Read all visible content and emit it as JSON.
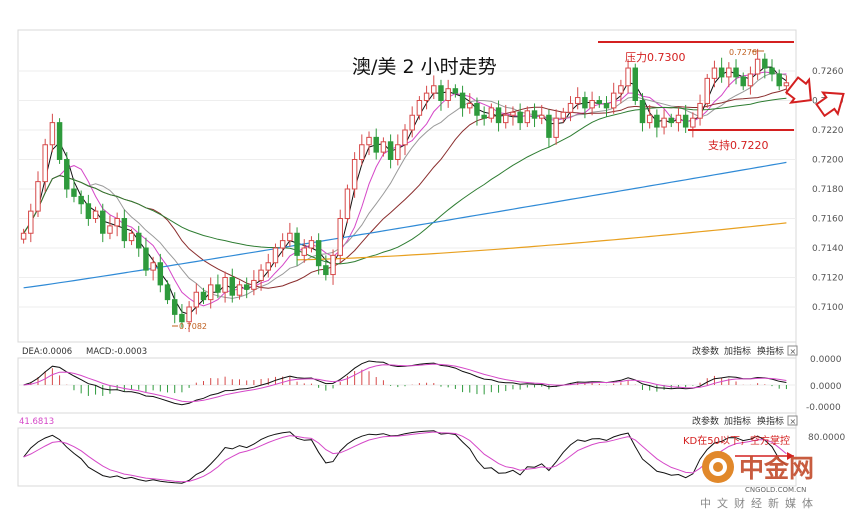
{
  "chart_data": [
    {
      "type": "candlestick",
      "title": "澳/美 2 小时走势",
      "ylim": [
        0.708,
        0.729
      ],
      "yticks": [
        "0.7260",
        "0.7240",
        "0.7220",
        "0.7200",
        "0.7180",
        "0.7160",
        "0.7140",
        "0.7120",
        "0.7100"
      ],
      "annotations": {
        "resistance": {
          "label": "压力0.7300",
          "value": 0.73
        },
        "support": {
          "label": "支持0.7220",
          "value": 0.722
        },
        "high": {
          "label": "0.7276",
          "value": 0.7276
        },
        "low": {
          "label": "0.7082",
          "value": 0.7082
        }
      },
      "colors": {
        "up": "#d64a4a",
        "down": "#2e9a3c",
        "ma_black": "#111111",
        "ma_magenta": "#d548c8",
        "ma_gray": "#9a9a9a",
        "ma_brown": "#8a2d2d",
        "ma_green": "#2e7d32",
        "ma_blue": "#2f8ad6",
        "ma_orange": "#e8a020"
      },
      "closes": [
        0.715,
        0.7165,
        0.7185,
        0.721,
        0.7225,
        0.72,
        0.718,
        0.7175,
        0.717,
        0.716,
        0.7165,
        0.715,
        0.7155,
        0.716,
        0.7145,
        0.715,
        0.714,
        0.7125,
        0.713,
        0.7115,
        0.7105,
        0.7095,
        0.709,
        0.71,
        0.711,
        0.7105,
        0.7115,
        0.711,
        0.712,
        0.7108,
        0.7115,
        0.7112,
        0.7118,
        0.7125,
        0.713,
        0.714,
        0.7145,
        0.715,
        0.7135,
        0.714,
        0.7145,
        0.7128,
        0.7122,
        0.7135,
        0.716,
        0.718,
        0.72,
        0.721,
        0.7215,
        0.7205,
        0.7212,
        0.72,
        0.721,
        0.722,
        0.723,
        0.724,
        0.7245,
        0.725,
        0.724,
        0.7248,
        0.7245,
        0.7235,
        0.7238,
        0.723,
        0.7228,
        0.7235,
        0.7225,
        0.723,
        0.7232,
        0.7225,
        0.7233,
        0.7228,
        0.723,
        0.7215,
        0.7228,
        0.7232,
        0.7238,
        0.7242,
        0.7235,
        0.724,
        0.7238,
        0.7235,
        0.7245,
        0.725,
        0.7262,
        0.724,
        0.7225,
        0.723,
        0.7222,
        0.7228,
        0.7225,
        0.723,
        0.7222,
        0.7228,
        0.7238,
        0.7255,
        0.7262,
        0.7256,
        0.7262,
        0.7256,
        0.725,
        0.7258,
        0.7268,
        0.7262,
        0.7258,
        0.725,
        0.7252
      ]
    },
    {
      "type": "line",
      "title": "MACD",
      "legend": [
        "DEA:0.0006",
        "MACD:-0.0003"
      ],
      "yticks": [
        "0.0000",
        "0.0000",
        "-0.0000"
      ],
      "buttons": [
        "改参数",
        "加指标",
        "换指标",
        "×"
      ]
    },
    {
      "type": "line",
      "title": "KD",
      "legend": [
        "41.6813"
      ],
      "yticks": [
        "80.0000"
      ],
      "annotation": "KD在50以下，空方掌控",
      "buttons": [
        "改参数",
        "加指标",
        "换指标",
        "×"
      ]
    }
  ],
  "watermark": {
    "brand": "中金网",
    "site": "CNGOLD.COM.CN",
    "tagline": "中文财经新媒体"
  }
}
